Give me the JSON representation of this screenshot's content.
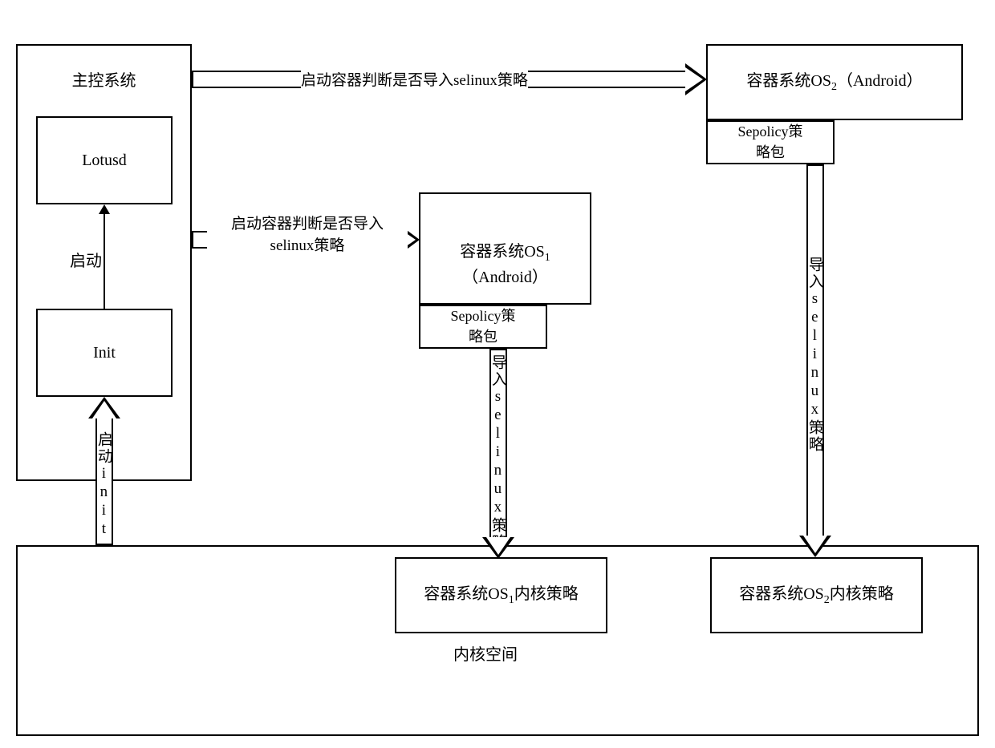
{
  "master": {
    "title": "主控系统",
    "lotusd": "Lotusd",
    "init": "Init",
    "start_label": "启动"
  },
  "os1": {
    "title_line1": "容器系统OS₁",
    "title_line2": "（Android）",
    "sepolicy": "Sepolicy策略包"
  },
  "os2": {
    "title_line1": "容器系统OS₂（Android）",
    "sepolicy": "Sepolicy策略包"
  },
  "kernel": {
    "title": "内核空间",
    "os1_policy": "容器系统OS₁内核策略",
    "os2_policy": "容器系统OS₂内核策略"
  },
  "arrows": {
    "to_os1": "启动容器判断是否导入selinux策略",
    "to_os2": "启动容器判断是否导入selinux策略",
    "init_up": "启动init",
    "os1_down": "导入selinux策略",
    "os2_down": "导入selinux策略"
  }
}
